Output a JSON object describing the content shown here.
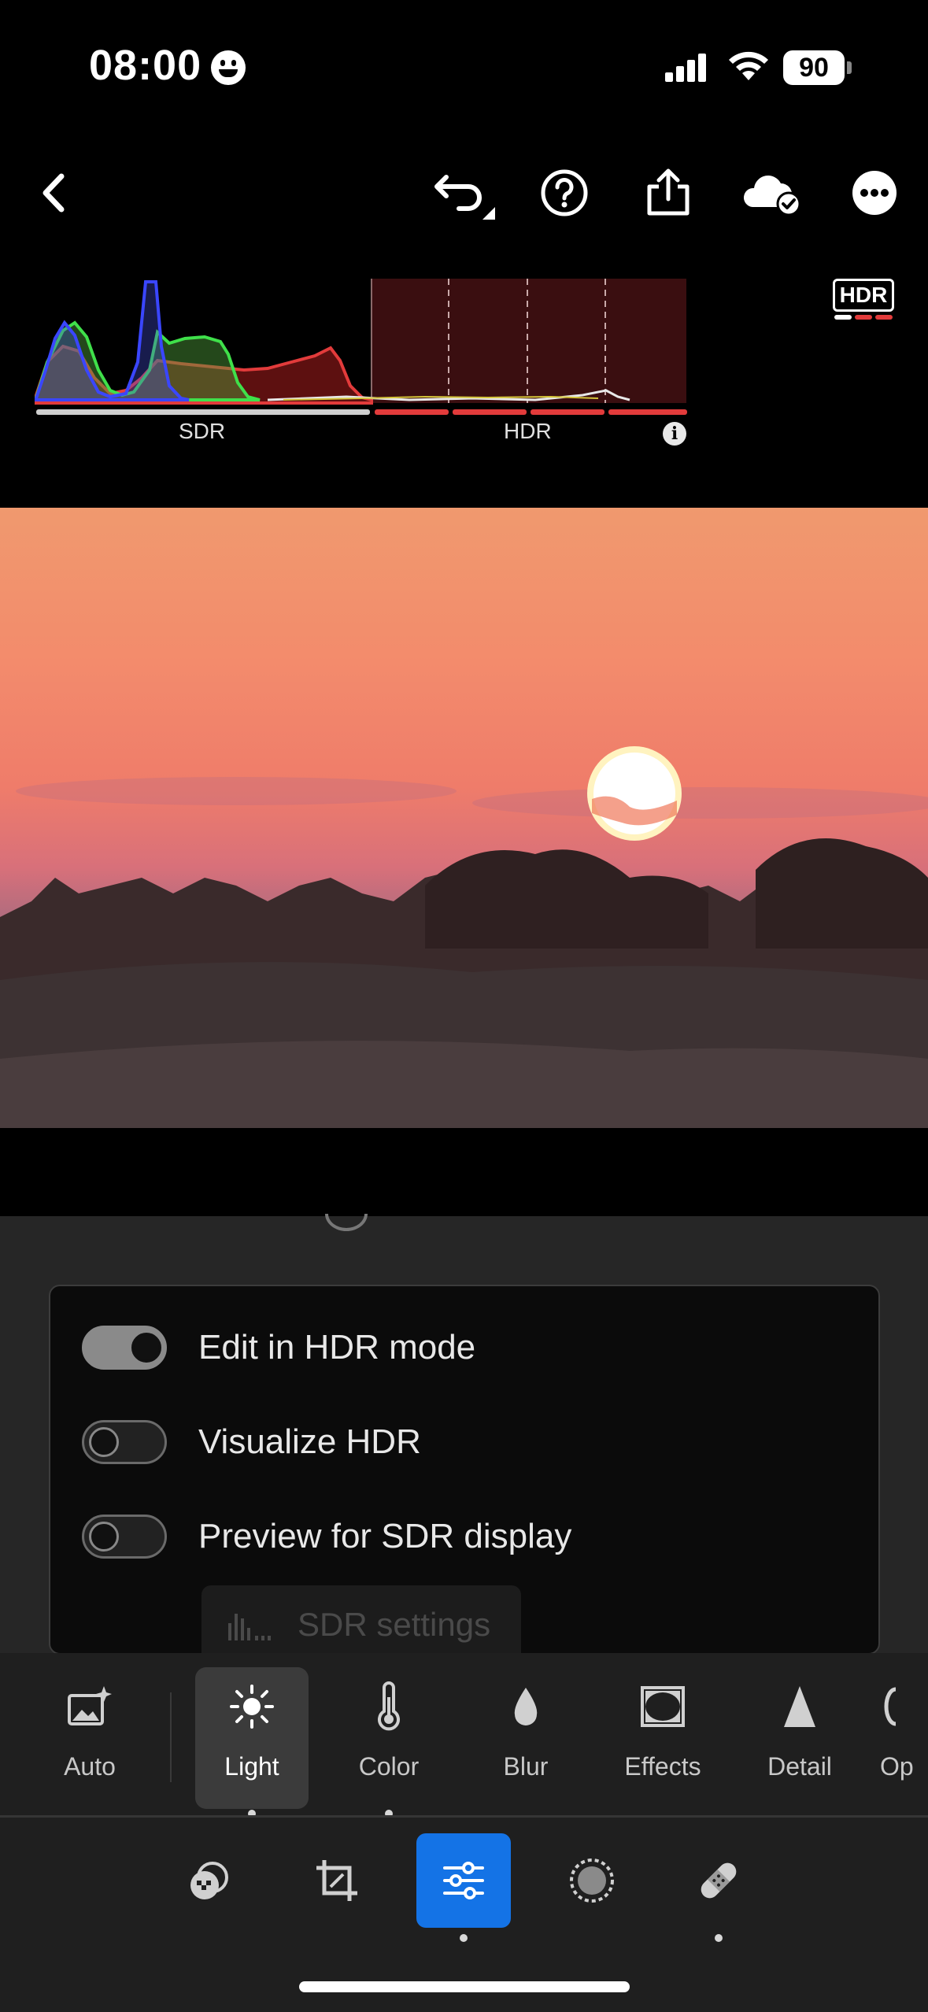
{
  "status_bar": {
    "time": "08:00",
    "battery": "90",
    "icons": [
      "smiley-face-icon",
      "cellular-signal-icon",
      "wifi-icon",
      "battery-icon"
    ]
  },
  "toolbar": {
    "icons": [
      "back-chevron-icon",
      "undo-icon",
      "help-icon",
      "share-icon",
      "cloud-synced-icon",
      "more-icon"
    ]
  },
  "histogram": {
    "sdr_label": "SDR",
    "hdr_label": "HDR",
    "badge": "HDR",
    "colors": {
      "red": "#e23b3b",
      "green": "#3fe04a",
      "blue": "#3a46ff",
      "hdr_zone": "#3a0e10"
    }
  },
  "hdr_options": [
    {
      "label": "Edit in HDR mode",
      "on": true
    },
    {
      "label": "Visualize HDR",
      "on": false
    },
    {
      "label": "Preview for SDR display",
      "on": false
    }
  ],
  "sdr_settings_label": "SDR settings",
  "tools": [
    {
      "label": "Auto",
      "icon": "auto-enhance-icon"
    },
    {
      "label": "Light",
      "icon": "sun-icon",
      "active": true
    },
    {
      "label": "Color",
      "icon": "thermometer-icon"
    },
    {
      "label": "Blur",
      "icon": "droplet-icon"
    },
    {
      "label": "Effects",
      "icon": "vignette-frame-icon"
    },
    {
      "label": "Detail",
      "icon": "triangle-icon"
    },
    {
      "label": "Op",
      "icon": "optics-icon"
    }
  ],
  "bottom_nav": {
    "icons": [
      "presets-icon",
      "crop-icon",
      "edit-sliders-icon",
      "masking-icon",
      "healing-bandage-icon"
    ],
    "active": "edit-sliders-icon",
    "accent": "#1473e6"
  }
}
